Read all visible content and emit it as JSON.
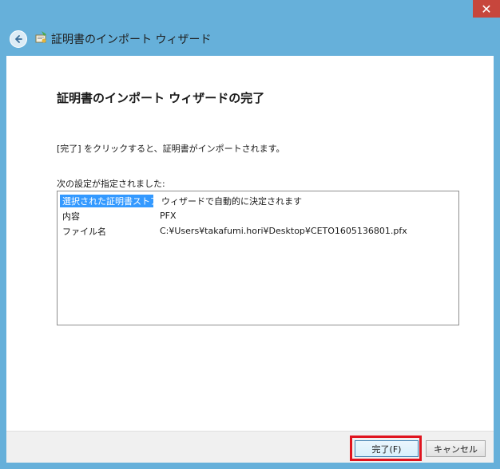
{
  "window": {
    "title": "証明書のインポート ウィザード",
    "close_glyph": "✕"
  },
  "page": {
    "heading": "証明書のインポート ウィザードの完了",
    "instruction": "[完了] をクリックすると、証明書がインポートされます。",
    "settings_label": "次の設定が指定されました:"
  },
  "settings": {
    "rows": [
      {
        "key": "選択された証明書ストア",
        "value": "ウィザードで自動的に決定されます",
        "selected": true
      },
      {
        "key": "内容",
        "value": "PFX",
        "selected": false
      },
      {
        "key": "ファイル名",
        "value": "C:¥Users¥takafumi.hori¥Desktop¥CETO1605136801.pfx",
        "selected": false
      }
    ]
  },
  "footer": {
    "finish_label": "完了(F)",
    "cancel_label": "キャンセル"
  },
  "colors": {
    "chrome": "#66b0da",
    "selection": "#3399ff",
    "highlight": "#e0141e",
    "close": "#c7463c"
  },
  "icons": {
    "back": "back-arrow-icon",
    "wizard": "certificate-wizard-icon"
  }
}
